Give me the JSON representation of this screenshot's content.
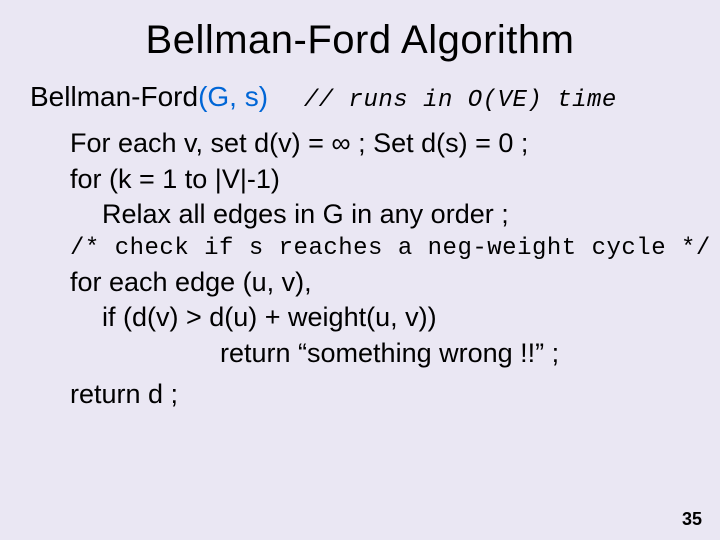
{
  "title": "Bellman-Ford Algorithm",
  "signature": {
    "fn": "Bellman-Ford",
    "args": "(G, s)",
    "comment_prefix": "// runs in ",
    "comment_em": "O(VE)",
    "comment_suffix": " time"
  },
  "lines": {
    "l1": "For each v, set d(v) = ∞ ; Set d(s) = 0 ;",
    "l2": "for (k = 1 to |V|-1)",
    "l3": "Relax all edges in G in any order ;",
    "l4": "/* check if s reaches a neg-weight cycle */",
    "l5": "for each edge (u, v),",
    "l6": "if (d(v) > d(u) + weight(u, v))",
    "l7": "return “something wrong !!” ;",
    "l8": "return d ;"
  },
  "page_number": "35"
}
